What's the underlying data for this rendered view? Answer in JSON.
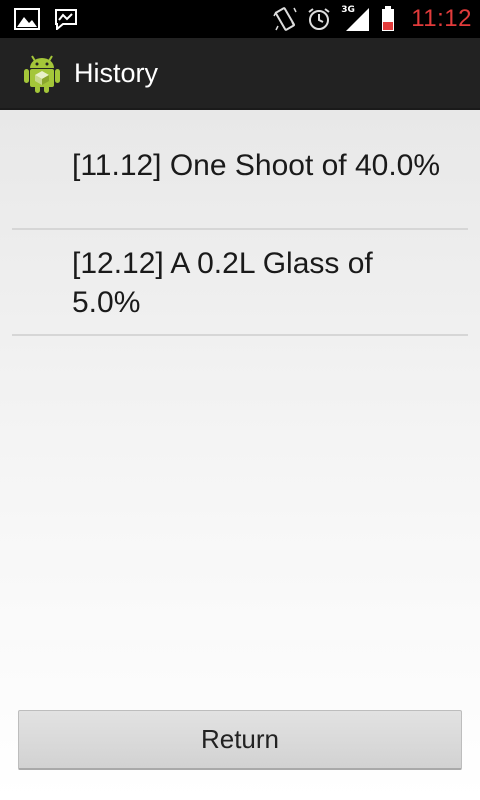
{
  "status_bar": {
    "left_icons": [
      "image-icon",
      "messenger-icon"
    ],
    "right_icons": [
      "vibrate-icon",
      "alarm-icon",
      "signal-3g-icon",
      "battery-icon"
    ],
    "network_label": "3G",
    "time": "11:12",
    "time_color": "#e23b3b",
    "battery_color": "#e23b3b"
  },
  "action_bar": {
    "title": "History",
    "icon": "android-app-icon",
    "background": "#222222"
  },
  "history": {
    "items": [
      {
        "text": "[11.12] One Shoot of 40.0%"
      },
      {
        "text": "[12.12] A 0.2L Glass of 5.0%"
      }
    ]
  },
  "footer": {
    "return_label": "Return"
  }
}
